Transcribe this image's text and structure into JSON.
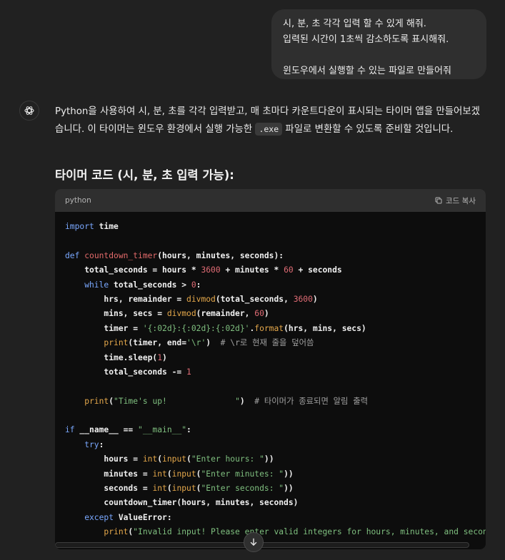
{
  "user_message": {
    "lines": [
      "시, 분, 초 각각 입력 할 수 있게 해줘.",
      "입력된 시간이 1초씩 감소하도록 표시해줘.",
      "",
      "윈도우에서 실행할 수 있는 파일로 만들어줘"
    ]
  },
  "assistant": {
    "avatar_icon": "openai-logo-icon",
    "intro_before": "Python을 사용하여 시, 분, 초를 각각 입력받고, 매 초마다 카운트다운이 표시되는 타이머 앱을 만들어보겠습니다. 이 타이머는 윈도우 환경에서 실행 가능한 ",
    "intro_code": ".exe",
    "intro_after": " 파일로 변환할 수 있도록 준비할 것입니다.",
    "heading": "타이머 코드 (시, 분, 초 입력 가능):"
  },
  "code_block": {
    "language": "python",
    "copy_label": "코드 복사",
    "copy_icon": "copy-icon",
    "lines": [
      [
        [
          "kw",
          "import"
        ],
        [
          "b",
          " time"
        ]
      ],
      [],
      [
        [
          "kw",
          "def"
        ],
        [
          "t",
          " "
        ],
        [
          "fn",
          "countdown_timer"
        ],
        [
          "b",
          "(hours, minutes, seconds):"
        ]
      ],
      [
        [
          "b",
          "    total_seconds = hours * "
        ],
        [
          "num",
          "3600"
        ],
        [
          "b",
          " + minutes * "
        ],
        [
          "num",
          "60"
        ],
        [
          "b",
          " + seconds"
        ]
      ],
      [
        [
          "kw",
          "    while"
        ],
        [
          "b",
          " total_seconds > "
        ],
        [
          "num",
          "0"
        ],
        [
          "b",
          ":"
        ]
      ],
      [
        [
          "b",
          "        hrs, remainder = "
        ],
        [
          "bi",
          "divmod"
        ],
        [
          "b",
          "(total_seconds, "
        ],
        [
          "num",
          "3600"
        ],
        [
          "b",
          ")"
        ]
      ],
      [
        [
          "b",
          "        mins, secs = "
        ],
        [
          "bi",
          "divmod"
        ],
        [
          "b",
          "(remainder, "
        ],
        [
          "num",
          "60"
        ],
        [
          "b",
          ")"
        ]
      ],
      [
        [
          "b",
          "        timer = "
        ],
        [
          "str",
          "'{:02d}:{:02d}:{:02d}'"
        ],
        [
          "b",
          "."
        ],
        [
          "bi",
          "format"
        ],
        [
          "b",
          "(hrs, mins, secs)"
        ]
      ],
      [
        [
          "bi",
          "        print"
        ],
        [
          "b",
          "(timer, end="
        ],
        [
          "str",
          "'\\r'"
        ],
        [
          "b",
          ")"
        ],
        [
          "cm",
          "  # \\r로 현재 줄을 덮어씀"
        ]
      ],
      [
        [
          "b",
          "        time.sleep("
        ],
        [
          "num",
          "1"
        ],
        [
          "b",
          ")"
        ]
      ],
      [
        [
          "b",
          "        total_seconds -= "
        ],
        [
          "num",
          "1"
        ]
      ],
      [],
      [
        [
          "bi",
          "    print"
        ],
        [
          "b",
          "("
        ],
        [
          "str",
          "\"Time's up!              \""
        ],
        [
          "b",
          ")"
        ],
        [
          "cm",
          "  # 타이머가 종료되면 알림 출력"
        ]
      ],
      [],
      [
        [
          "kw",
          "if"
        ],
        [
          "b",
          " __name__ == "
        ],
        [
          "str",
          "\"__main__\""
        ],
        [
          "b",
          ":"
        ]
      ],
      [
        [
          "kw",
          "    try"
        ],
        [
          "b",
          ":"
        ]
      ],
      [
        [
          "b",
          "        hours = "
        ],
        [
          "bi",
          "int"
        ],
        [
          "b",
          "("
        ],
        [
          "bi",
          "input"
        ],
        [
          "b",
          "("
        ],
        [
          "str",
          "\"Enter hours: \""
        ],
        [
          "b",
          "))"
        ]
      ],
      [
        [
          "b",
          "        minutes = "
        ],
        [
          "bi",
          "int"
        ],
        [
          "b",
          "("
        ],
        [
          "bi",
          "input"
        ],
        [
          "b",
          "("
        ],
        [
          "str",
          "\"Enter minutes: \""
        ],
        [
          "b",
          "))"
        ]
      ],
      [
        [
          "b",
          "        seconds = "
        ],
        [
          "bi",
          "int"
        ],
        [
          "b",
          "("
        ],
        [
          "bi",
          "input"
        ],
        [
          "b",
          "("
        ],
        [
          "str",
          "\"Enter seconds: \""
        ],
        [
          "b",
          "))"
        ]
      ],
      [
        [
          "b",
          "        countdown_timer(hours, minutes, seconds)"
        ]
      ],
      [
        [
          "kw",
          "    except"
        ],
        [
          "b",
          " ValueError:"
        ]
      ],
      [
        [
          "bi",
          "        print"
        ],
        [
          "b",
          "("
        ],
        [
          "str",
          "\"Invalid input! Please enter valid integers for hours, minutes, and seconds."
        ]
      ]
    ]
  },
  "scroll_down_icon": "arrow-down-icon"
}
